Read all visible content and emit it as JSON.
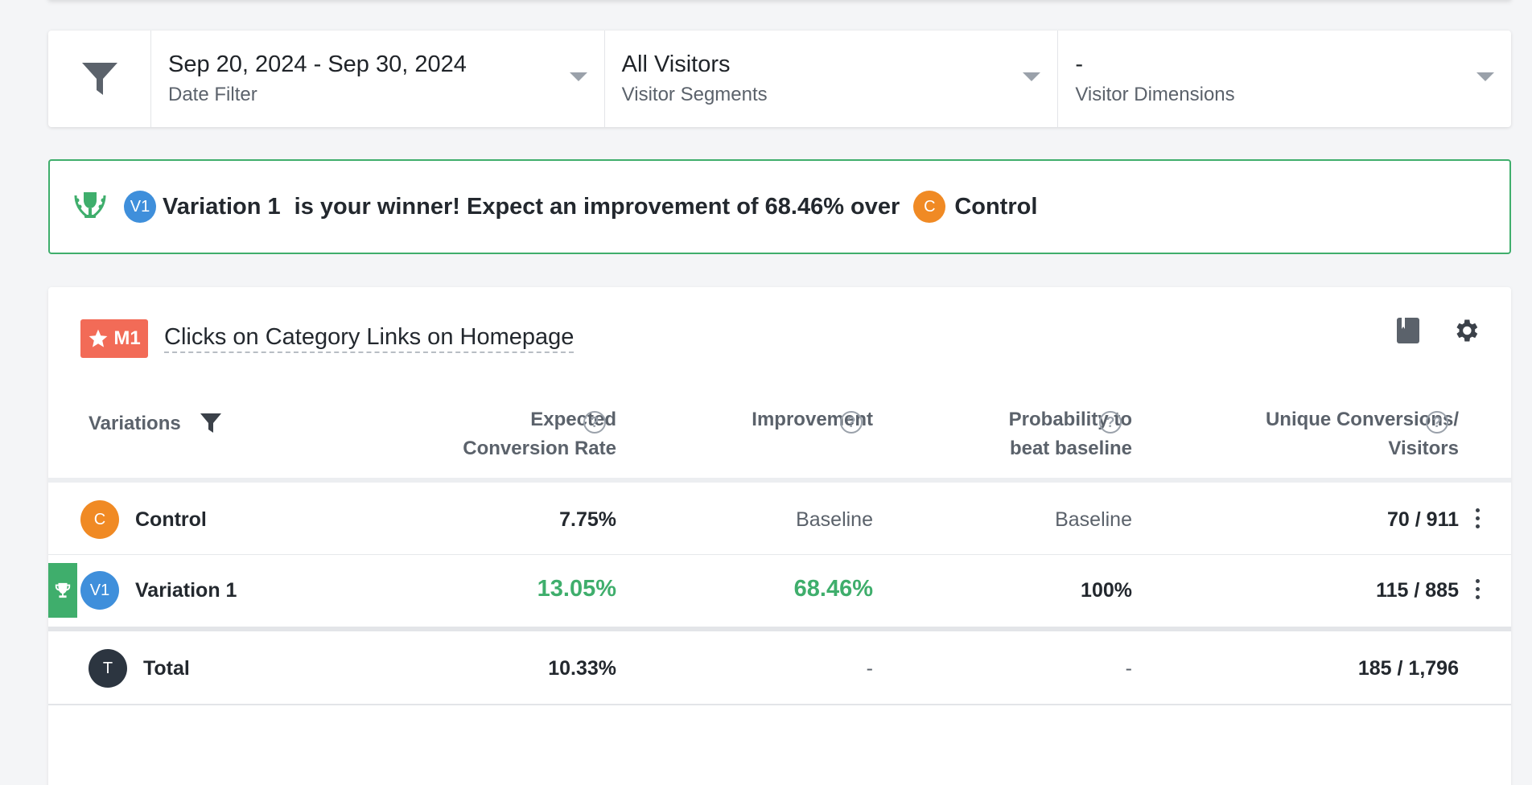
{
  "filters": {
    "date": {
      "value": "Sep 20, 2024 - Sep 30, 2024",
      "label": "Date Filter"
    },
    "segments": {
      "value": "All Visitors",
      "label": "Visitor Segments"
    },
    "dimensions": {
      "value": "-",
      "label": "Visitor Dimensions"
    }
  },
  "banner": {
    "winner_badge": "V1",
    "winner_name": "Variation 1",
    "message": "is your winner! Expect an improvement of 68.46% over",
    "baseline_badge": "C",
    "baseline_name": "Control"
  },
  "metric": {
    "badge": "M1",
    "title": "Clicks on Category Links on Homepage"
  },
  "table": {
    "headers": {
      "variations": "Variations",
      "expected_line1": "Expected",
      "expected_line2": "Conversion Rate",
      "improvement": "Improvement",
      "probability_line1": "Probability to",
      "probability_line2": "beat baseline",
      "unique_line1": "Unique Conversions/",
      "unique_line2": "Visitors"
    },
    "help_glyph": "?",
    "rows": [
      {
        "badge": "C",
        "name": "Control",
        "conversion_rate": "7.75%",
        "improvement": "Baseline",
        "probability": "Baseline",
        "conversions": "70 / 911"
      },
      {
        "badge": "V1",
        "name": "Variation 1",
        "conversion_rate": "13.05%",
        "improvement": "68.46%",
        "probability": "100%",
        "conversions": "115 / 885"
      }
    ],
    "total": {
      "badge": "T",
      "name": "Total",
      "conversion_rate": "10.33%",
      "improvement": "-",
      "probability": "-",
      "conversions": "185 / 1,796"
    }
  },
  "colors": {
    "winner_green": "#3fae6c",
    "control_orange": "#f08a24",
    "variation_blue": "#3f8fdb",
    "metric_badge": "#f26b57",
    "total_dark": "#2c3540"
  }
}
